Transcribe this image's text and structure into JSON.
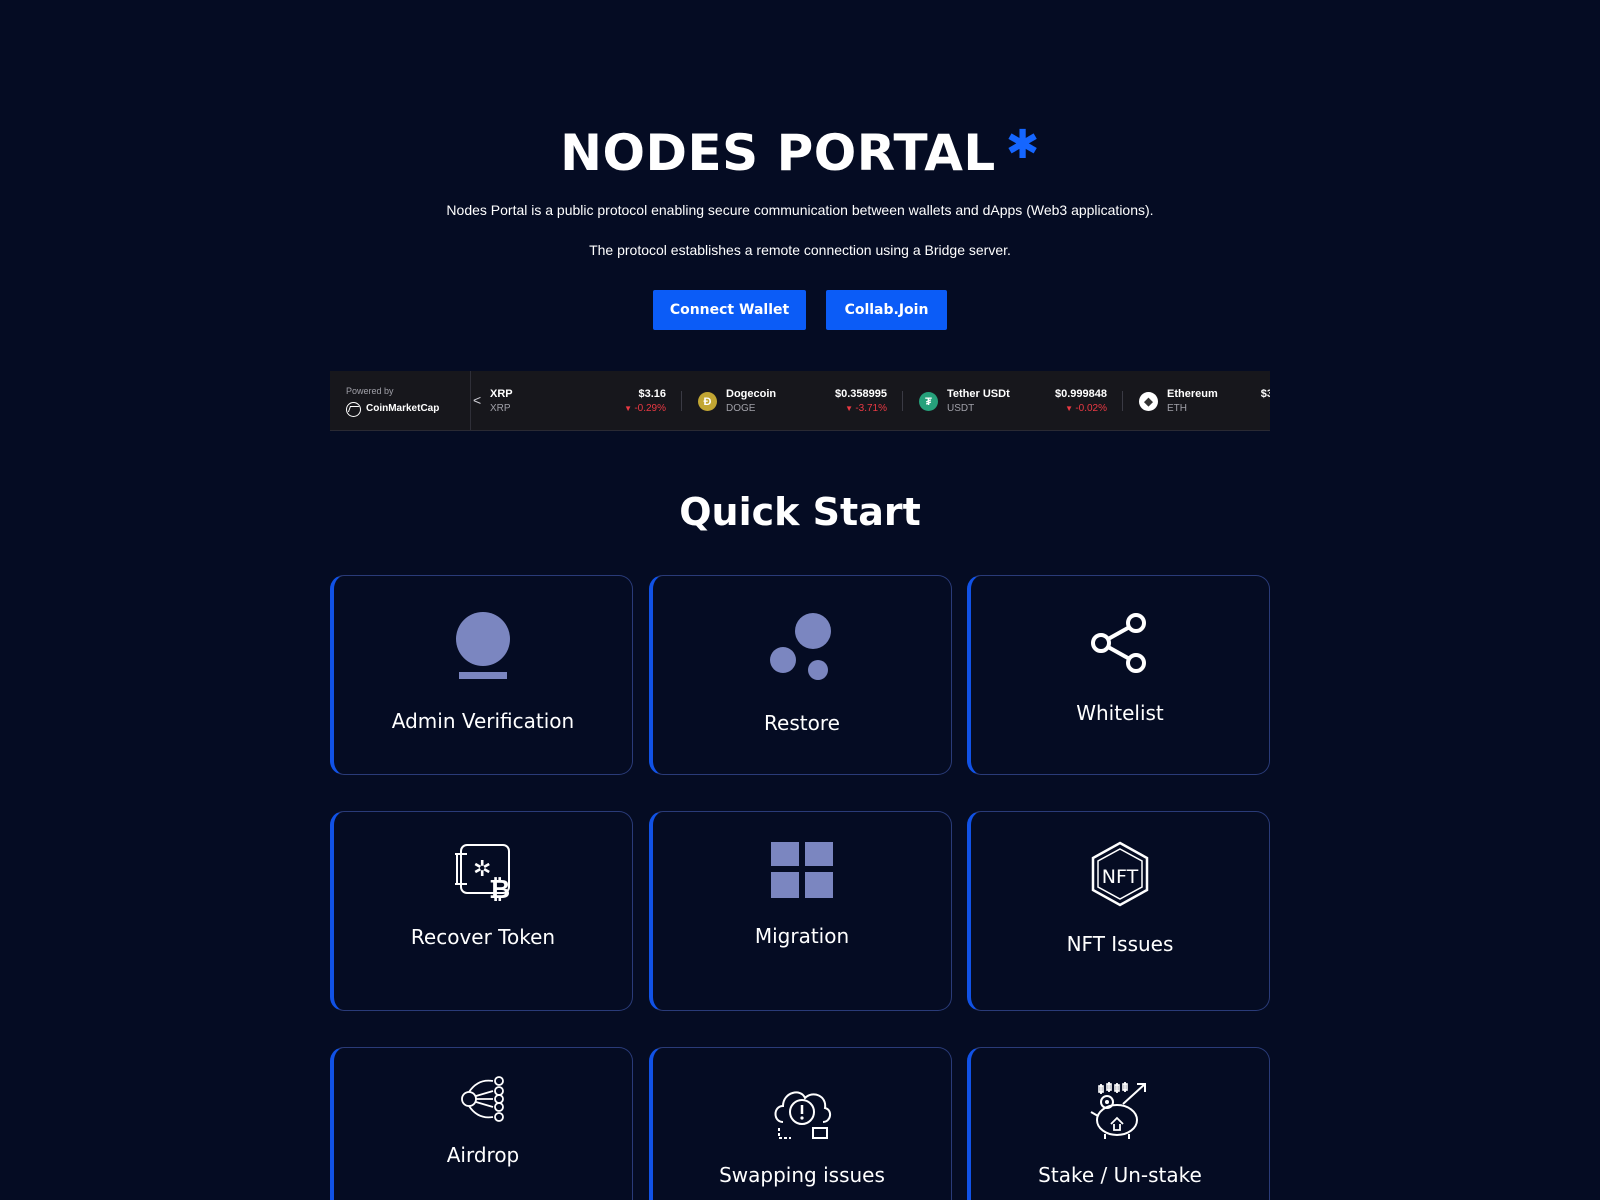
{
  "hero": {
    "title": "NODES PORTAL",
    "title_mark": "✱",
    "description_1": "Nodes Portal is a public protocol enabling secure communication between wallets and dApps (Web3 applications).",
    "description_2": "The protocol establishes a remote connection using a Bridge server.",
    "connect_label": "Connect Wallet",
    "collab_label": "Collab.Join"
  },
  "ticker": {
    "powered_by": "Powered by",
    "provider": "CoinMarketCap",
    "coins": [
      {
        "name": "XRP",
        "symbol": "XRP",
        "price": "$3.16",
        "change": "-0.29%"
      },
      {
        "name": "Dogecoin",
        "symbol": "DOGE",
        "price": "$0.358995",
        "change": "-3.71%"
      },
      {
        "name": "Tether USDt",
        "symbol": "USDT",
        "price": "$0.999848",
        "change": "-0.02%"
      },
      {
        "name": "Ethereum",
        "symbol": "ETH",
        "price": "$3",
        "change": ""
      }
    ],
    "colors": {
      "negative": "#ea3943",
      "doge": "#c2a633",
      "tether": "#26a17b"
    }
  },
  "quick_start": {
    "title": "Quick Start",
    "cards": [
      {
        "label": "Admin Verification",
        "icon": "user-icon"
      },
      {
        "label": "Restore",
        "icon": "bubbles-icon"
      },
      {
        "label": "Whitelist",
        "icon": "share-icon"
      },
      {
        "label": "Recover Token",
        "icon": "bitcoin-recover-icon"
      },
      {
        "label": "Migration",
        "icon": "grid-icon"
      },
      {
        "label": "NFT Issues",
        "icon": "nft-icon"
      },
      {
        "label": "Airdrop",
        "icon": "airdrop-icon"
      },
      {
        "label": "Swapping issues",
        "icon": "cloud-alert-icon"
      },
      {
        "label": "Stake / Un-stake",
        "icon": "piggy-stake-icon"
      }
    ]
  },
  "colors": {
    "background": "#050c23",
    "accent": "#0b5cf7",
    "icon_fill": "#7b86c0"
  }
}
